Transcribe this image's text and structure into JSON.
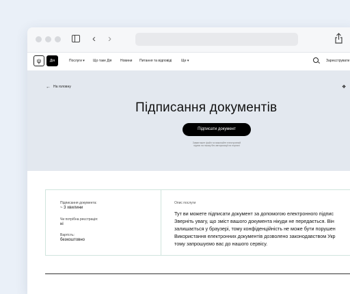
{
  "nav": {
    "logo_text": "Дія",
    "items": [
      "Послуги",
      "Що таке Дія",
      "Новини",
      "Питання та відповіді",
      "Ще"
    ],
    "register": "Зареєструвати"
  },
  "hero": {
    "back": "На головну",
    "title": "Підписання документів",
    "button": "Підписати документ",
    "note": "Завантажте файл та виконайте електронний підпис на ньому без авторизації на порталі"
  },
  "info": {
    "duration_label": "Підписання документа:",
    "duration_value": "~ 3 хвилини",
    "registration_label": "Чи потрібна реєстрація:",
    "registration_value": "ні",
    "cost_label": "Вартість:",
    "cost_value": "безкоштовно",
    "description_label": "Опис послуги",
    "description_lines": [
      "Тут ви можете підписати документ за допомогою електронного підпис",
      "Зверніть увагу, що зміст вашого документа нікуди не передається. Він",
      "залишається у браузері, тому конфіденційність не може бути порушен",
      "Використання електронних документів дозволено законодавством Укр",
      "тому запрошуємо вас до нашого сервісу."
    ]
  },
  "icons": [
    "close-dot",
    "minimize-dot",
    "maximize-dot",
    "sidebar-icon",
    "back-icon",
    "forward-icon",
    "share-icon",
    "trident-icon",
    "search-icon",
    "arrow-left-icon",
    "bookmark-icon"
  ]
}
